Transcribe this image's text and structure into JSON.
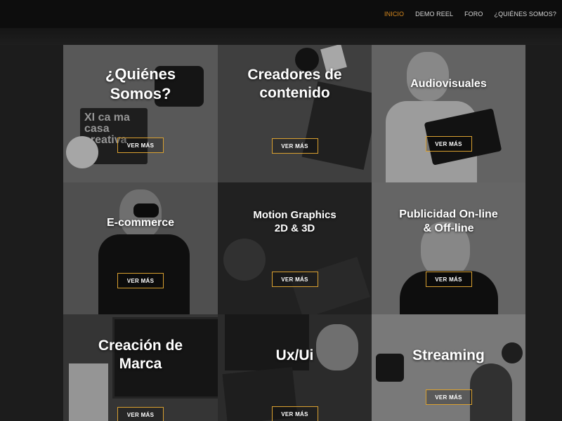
{
  "nav": {
    "items": [
      "INICIO",
      "DEMO REEL",
      "FORO",
      "¿QUIÉNES SOMOS?"
    ],
    "active_index": 0,
    "active_color": "#d98a1e"
  },
  "tiles": [
    {
      "title_line1": "¿Quiénes",
      "title_line2": "Somos?",
      "button": "VER MÁS",
      "logo_text": "XI ca ma casa creativa"
    },
    {
      "title_line1": "Creadores de",
      "title_line2": "contenido",
      "button": "VER MÁS"
    },
    {
      "title_line1": "Audiovisuales",
      "title_line2": "",
      "button": "VER MÁS"
    },
    {
      "title_line1": "E-commerce",
      "title_line2": "",
      "button": "VER MÁS"
    },
    {
      "title_line1": "Motion Graphics",
      "title_line2": "2D & 3D",
      "button": "VER MÁS"
    },
    {
      "title_line1": "Publicidad On-line",
      "title_line2": "& Off-line",
      "button": "VER MÁS"
    },
    {
      "title_line1": "Creación de",
      "title_line2": "Marca",
      "button": "VER MÁS"
    },
    {
      "title_line1": "Ux/Ui",
      "title_line2": "",
      "button": "VER MÁS"
    },
    {
      "title_line1": "Streaming",
      "title_line2": "",
      "button": "VER MÁS"
    }
  ],
  "colors": {
    "button_border": "#d9a030",
    "page_bg": "#1c1c1c"
  }
}
